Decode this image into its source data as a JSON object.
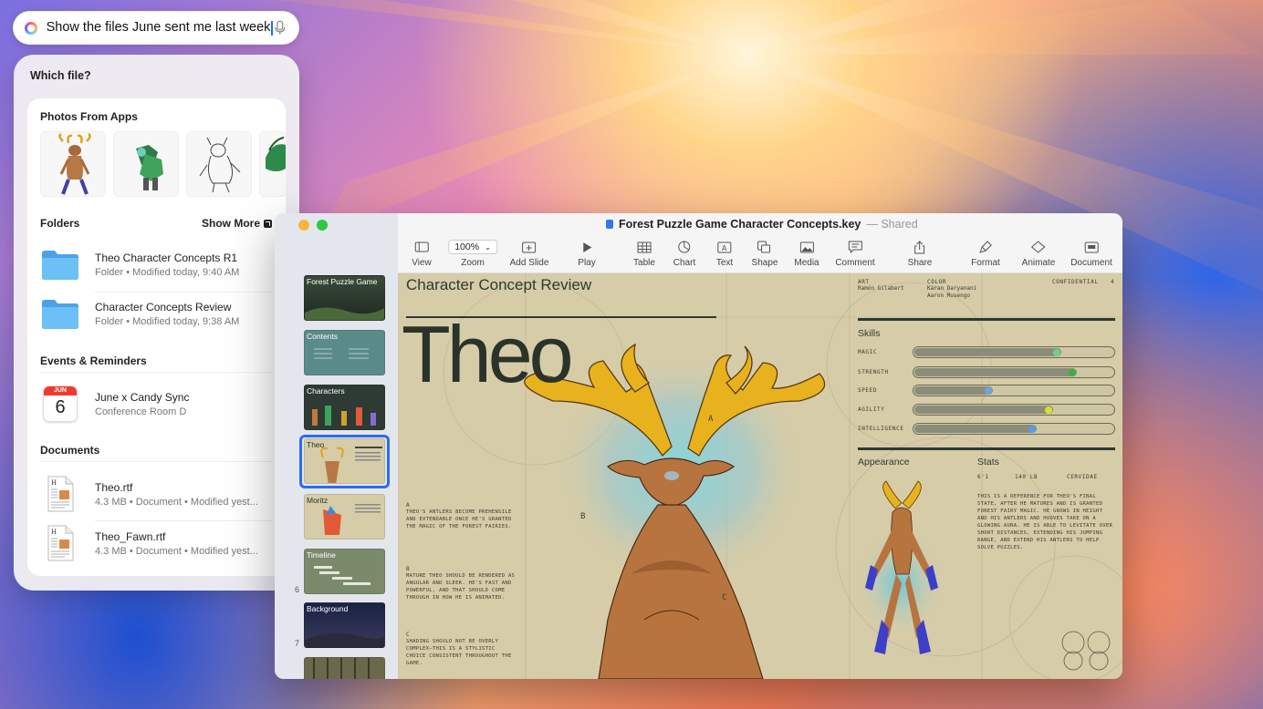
{
  "search": {
    "query": "Show the files June sent me last week"
  },
  "panel": {
    "title": "Which file?",
    "photos_title": "Photos From Apps",
    "folders_title": "Folders",
    "show_more": "Show More",
    "folders": [
      {
        "name": "Theo Character Concepts R1",
        "meta": "Folder • Modified today, 9:40 AM"
      },
      {
        "name": "Character Concepts Review",
        "meta": "Folder • Modified today, 9:38 AM"
      }
    ],
    "events_title": "Events & Reminders",
    "event": {
      "month": "JUN",
      "day": "6",
      "title": "June x Candy Sync",
      "location": "Conference Room D"
    },
    "documents_title": "Documents",
    "documents": [
      {
        "name": "Theo.rtf",
        "meta": "4.3 MB • Document • Modified yest..."
      },
      {
        "name": "Theo_Fawn.rtf",
        "meta": "4.3 MB • Document • Modified yest..."
      }
    ]
  },
  "keynote": {
    "doc_title": "Forest Puzzle Game Character Concepts.key",
    "shared": "— Shared",
    "zoom": "100%",
    "toolbar": [
      "View",
      "Zoom",
      "Add Slide",
      "Play",
      "Table",
      "Chart",
      "Text",
      "Shape",
      "Media",
      "Comment",
      "Share",
      "Format",
      "Animate",
      "Document"
    ],
    "slides": [
      {
        "title": "Forest Puzzle Game",
        "num": ""
      },
      {
        "title": "Contents",
        "num": ""
      },
      {
        "title": "Characters",
        "num": ""
      },
      {
        "title": "Theo",
        "num": ""
      },
      {
        "title": "Moritz",
        "num": ""
      },
      {
        "title": "Timeline",
        "num": "6"
      },
      {
        "title": "Background",
        "num": "7"
      }
    ],
    "slide": {
      "title": "Character Concept Review",
      "heading": "Theo",
      "art_label": "ART",
      "art_name": "Ramón Gilabert",
      "color_label": "COLOR",
      "color_names": "Karan Daryanani\nAaron Musengo",
      "confidential": "CONFIDENTIAL",
      "page": "4",
      "skills_title": "Skills",
      "skills": [
        {
          "name": "MAGIC",
          "value": 0.73,
          "color": "#6fcf8a"
        },
        {
          "name": "STRENGTH",
          "value": 0.81,
          "color": "#3fae3f"
        },
        {
          "name": "SPEED",
          "value": 0.39,
          "color": "#6fa3e0"
        },
        {
          "name": "AGILITY",
          "value": 0.69,
          "color": "#d6e035"
        },
        {
          "name": "INTELLIGENCE",
          "value": 0.61,
          "color": "#5a9be8"
        }
      ],
      "appearance": "Appearance",
      "stats": "Stats",
      "stat_height": "6'1",
      "stat_weight": "140 LB",
      "stat_species": "CERVIDAE",
      "stats_text": "THIS IS A REFERENCE FOR THEO'S FINAL STATE, AFTER HE MATURES AND IS GRANTED FOREST FAIRY MAGIC. HE GROWS IN HEIGHT AND HIS ANTLERS AND HOOVES TAKE ON A GLOWING AURA. HE IS ABLE TO LEVITATE OVER SHORT DISTANCES, EXTENDING HIS JUMPING RANGE, AND EXTEND HIS ANTLERS TO HELP SOLVE PUZZLES.",
      "note_a_label": "A",
      "note_a": "THEO'S ANTLERS BECOME PREHENSILE AND EXTENDABLE ONCE HE'S GRANTED THE MAGIC OF THE FOREST FAIRIES.",
      "note_b_label": "B",
      "note_b": "MATURE THEO SHOULD BE RENDERED AS ANGULAR AND SLEEK. HE'S FAST AND POWERFUL, AND THAT SHOULD COME THROUGH IN HOW HE IS ANIMATED.",
      "note_c_label": "C",
      "note_c": "SHADING SHOULD NOT BE OVERLY COMPLEX—THIS IS A STYLISTIC CHOICE CONSISTENT THROUGHOUT THE GAME.",
      "mark_a": "A",
      "mark_b": "B",
      "mark_c": "C"
    }
  }
}
